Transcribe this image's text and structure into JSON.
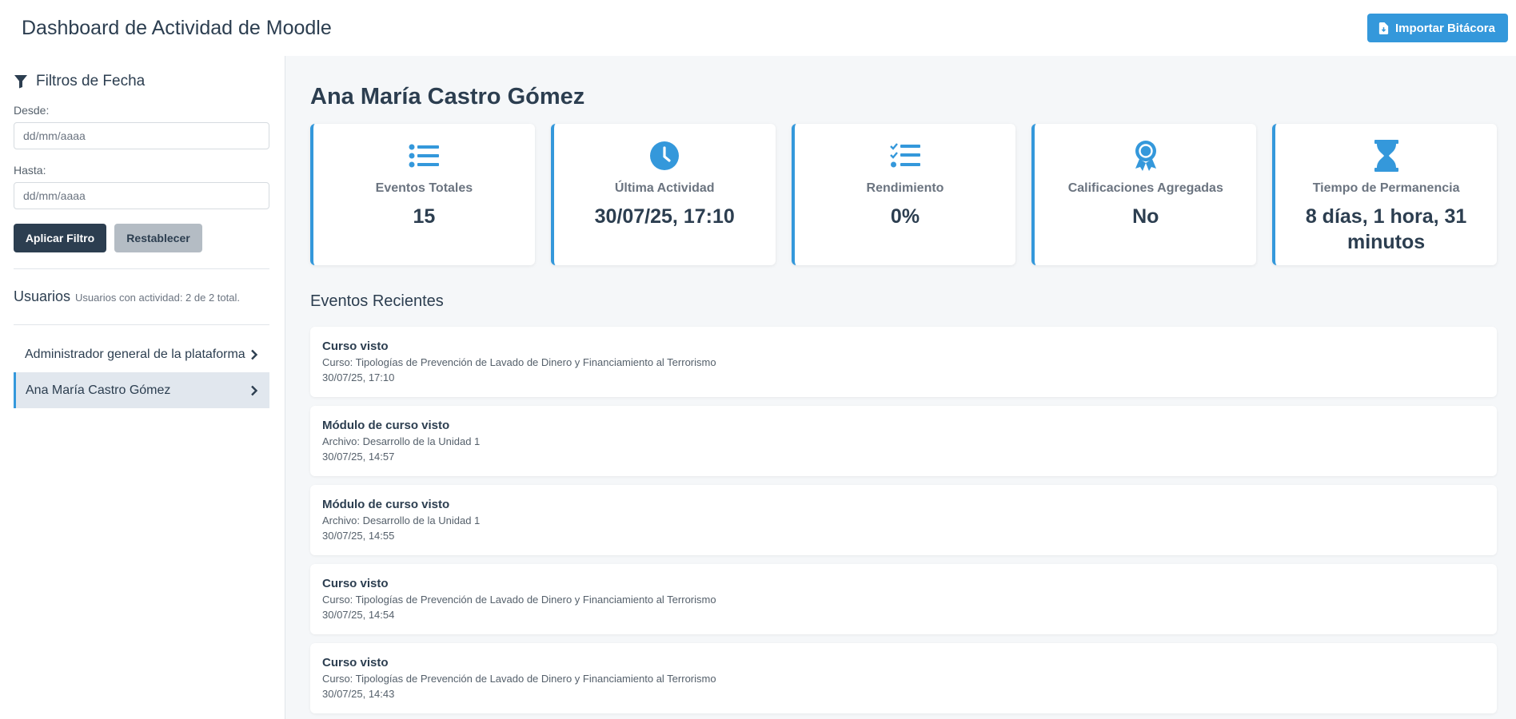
{
  "header": {
    "title": "Dashboard de Actividad de Moodle",
    "import_label": "Importar Bitácora"
  },
  "filters": {
    "title": "Filtros de Fecha",
    "from_label": "Desde:",
    "from_placeholder": "dd/mm/aaaa",
    "to_label": "Hasta:",
    "to_placeholder": "dd/mm/aaaa",
    "apply_label": "Aplicar Filtro",
    "reset_label": "Restablecer"
  },
  "users": {
    "title": "Usuarios",
    "subtitle": "Usuarios con actividad: 2 de 2 total.",
    "items": [
      {
        "name": "Administrador general de la plataforma",
        "active": false
      },
      {
        "name": "Ana María Castro Gómez",
        "active": true
      }
    ]
  },
  "main": {
    "user_name": "Ana María Castro Gómez",
    "stats": [
      {
        "icon": "list-icon",
        "label": "Eventos Totales",
        "value": "15"
      },
      {
        "icon": "clock-icon",
        "label": "Última Actividad",
        "value": "30/07/25, 17:10"
      },
      {
        "icon": "checklist-icon",
        "label": "Rendimiento",
        "value": "0%"
      },
      {
        "icon": "award-icon",
        "label": "Calificaciones Agregadas",
        "value": "No"
      },
      {
        "icon": "hourglass-icon",
        "label": "Tiempo de Permanencia",
        "value": "8 días, 1 hora, 31 minutos"
      }
    ],
    "events_title": "Eventos Recientes",
    "events": [
      {
        "title": "Curso visto",
        "detail": "Curso: Tipologías de Prevención de Lavado de Dinero y Financiamiento al Terrorismo",
        "time": "30/07/25, 17:10"
      },
      {
        "title": "Módulo de curso visto",
        "detail": "Archivo: Desarrollo de la Unidad 1",
        "time": "30/07/25, 14:57"
      },
      {
        "title": "Módulo de curso visto",
        "detail": "Archivo: Desarrollo de la Unidad 1",
        "time": "30/07/25, 14:55"
      },
      {
        "title": "Curso visto",
        "detail": "Curso: Tipologías de Prevención de Lavado de Dinero y Financiamiento al Terrorismo",
        "time": "30/07/25, 14:54"
      },
      {
        "title": "Curso visto",
        "detail": "Curso: Tipologías de Prevención de Lavado de Dinero y Financiamiento al Terrorismo",
        "time": "30/07/25, 14:43"
      }
    ]
  },
  "colors": {
    "accent": "#3498db",
    "dark": "#2c3e50",
    "muted": "#6b7480",
    "reset_button": "#b4bcc4"
  }
}
